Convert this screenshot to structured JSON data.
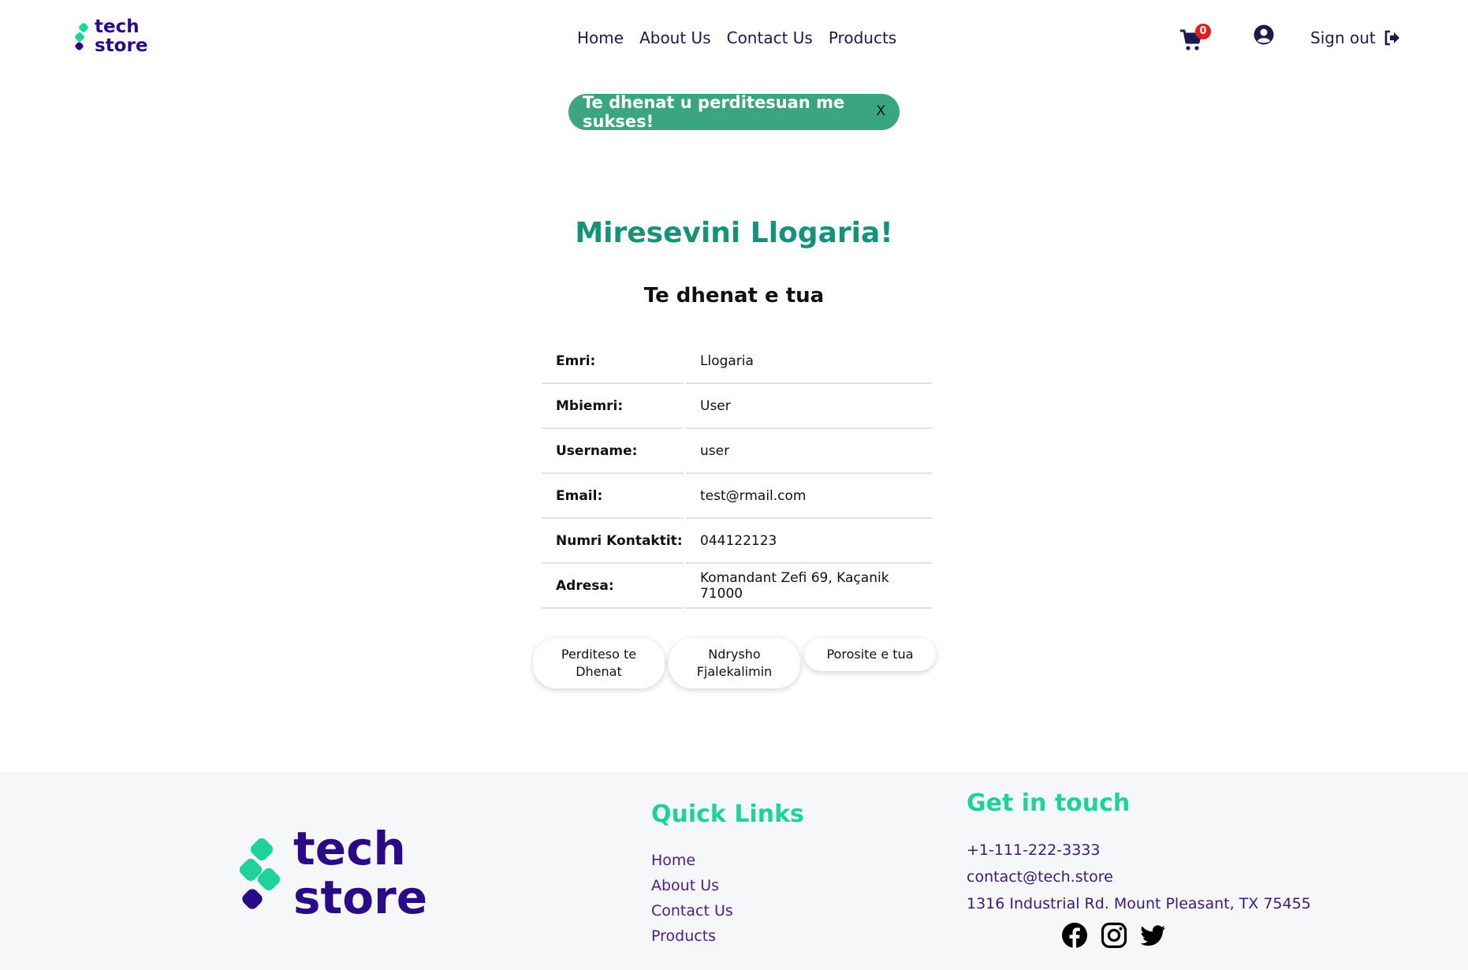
{
  "header": {
    "logo_line1": "tech",
    "logo_line2": "store",
    "nav": [
      "Home",
      "About Us",
      "Contact Us",
      "Products"
    ],
    "cart_count": "0",
    "signout_label": "Sign out"
  },
  "alert": {
    "message": "Te dhenat u perditesuan me sukses!",
    "close_label": "X"
  },
  "main": {
    "welcome": "Miresevini Llogaria!",
    "subtitle": "Te dhenat e tua",
    "rows": [
      {
        "label": "Emri:",
        "value": "Llogaria"
      },
      {
        "label": "Mbiemri:",
        "value": "User"
      },
      {
        "label": "Username:",
        "value": "user"
      },
      {
        "label": "Email:",
        "value": "test@rmail.com"
      },
      {
        "label": "Numri Kontaktit:",
        "value": "044122123"
      },
      {
        "label": "Adresa:",
        "value": "Komandant Zefi 69, Kaçanik 71000"
      }
    ],
    "buttons": [
      "Perditeso te Dhenat",
      "Ndrysho Fjalekalimin",
      "Porosite e tua"
    ]
  },
  "footer": {
    "quick_links_title": "Quick Links",
    "quick_links": [
      "Home",
      "About Us",
      "Contact Us",
      "Products"
    ],
    "contact_title": "Get in touch",
    "phone": "+1-111-222-3333",
    "email": "contact@tech.store",
    "address": "1316 Industrial Rd. Mount Pleasant, TX 75455",
    "social_icons": [
      "facebook-icon",
      "instagram-icon",
      "twitter-icon"
    ]
  },
  "colors": {
    "brand_purple": "#2a0b87",
    "brand_green": "#1ed39a",
    "welcome_green": "#15927a",
    "alert_green": "#3aa57e",
    "badge_red": "#e41b1b"
  }
}
